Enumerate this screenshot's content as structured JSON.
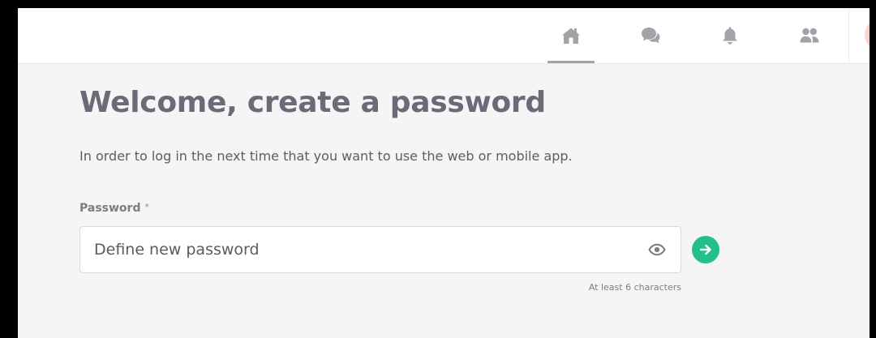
{
  "nav": {
    "items": [
      {
        "id": "home",
        "icon": "home-icon",
        "active": true
      },
      {
        "id": "chat",
        "icon": "chat-bubbles-icon",
        "active": false
      },
      {
        "id": "notifications",
        "icon": "bell-icon",
        "active": false
      },
      {
        "id": "people",
        "icon": "people-icon",
        "active": false
      }
    ]
  },
  "main": {
    "title": "Welcome, create a password",
    "subtitle": "In order to log in the next time that you want to use the web or mobile app.",
    "password_field": {
      "label": "Password",
      "required_mark": "*",
      "placeholder": "Define new password",
      "value": "",
      "hint": "At least 6 characters"
    },
    "submit_icon": "arrow-right-icon",
    "reveal_icon": "eye-icon"
  },
  "colors": {
    "accent": "#23c08a",
    "title": "#6b6b78",
    "nav_icon": "#a2a2a9",
    "background": "#f5f5f6"
  }
}
